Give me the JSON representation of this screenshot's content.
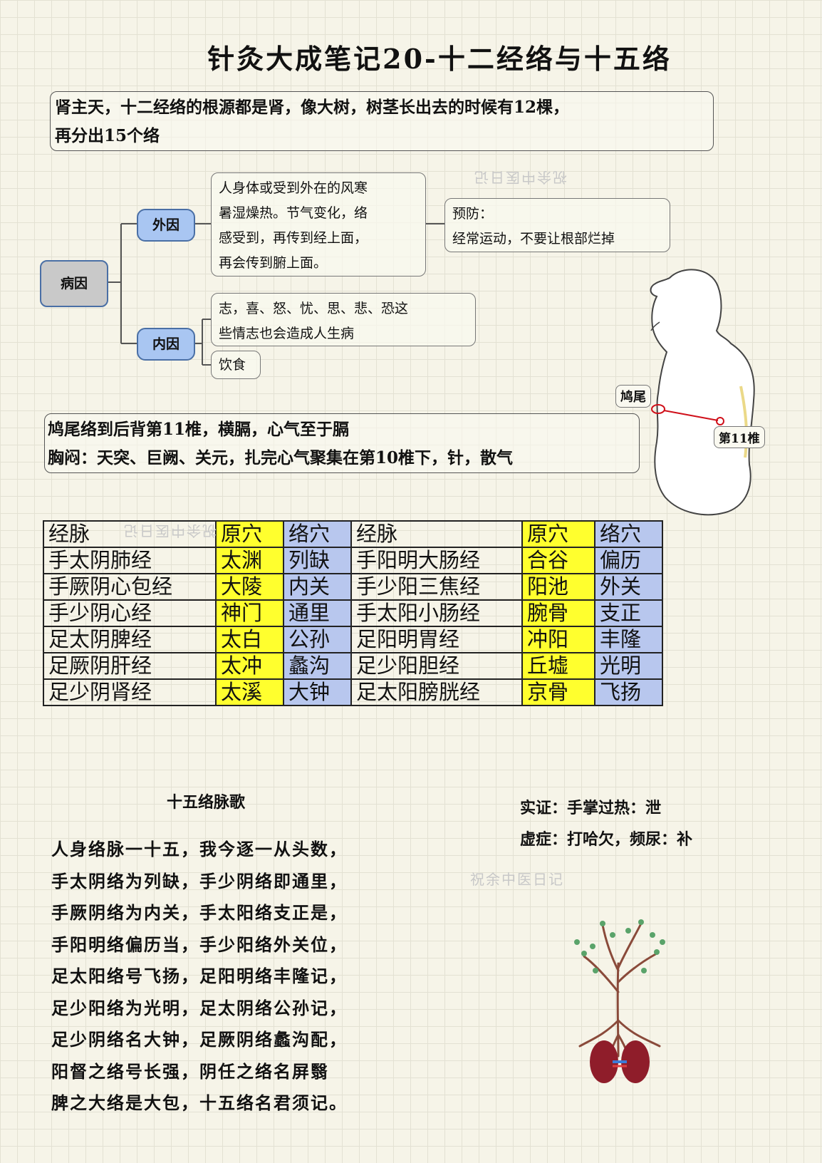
{
  "title": "针灸大成笔记20-十二经络与十五络",
  "intro": {
    "line1": "肾主天，十二经络的根源都是肾，像大树，树茎长出去的时候有12棵，",
    "line2": "再分出15个络"
  },
  "mindmap": {
    "root": "病因",
    "waiyin": {
      "label": "外因",
      "desc": [
        "人身体或受到外在的风寒",
        "暑湿燥热。节气变化，络",
        "感受到，再传到经上面，",
        "再会传到腑上面。"
      ],
      "prevention": [
        "预防：",
        "经常运动，不要让根部烂掉"
      ]
    },
    "neiyin": {
      "label": "内因",
      "emotions": [
        "志，喜、怒、忧、思、悲、恐这",
        "些情志也会造成人生病"
      ],
      "diet": "饮食"
    }
  },
  "figure": {
    "label_jiuwei": "鸠尾",
    "label_vertebra": "第11椎"
  },
  "jiuwei_note": {
    "line1": "鸠尾络到后背第11椎，横膈，心气至于膈",
    "line2": "胸闷：天突、巨阙、关元，扎完心气聚集在第10椎下，针，散气"
  },
  "table": {
    "headers": [
      "经脉",
      "原穴",
      "络穴",
      "经脉",
      "原穴",
      "络穴"
    ],
    "rows": [
      [
        "手太阴肺经",
        "太渊",
        "列缺",
        "手阳明大肠经",
        "合谷",
        "偏历"
      ],
      [
        "手厥阴心包经",
        "大陵",
        "内关",
        "手少阳三焦经",
        "阳池",
        "外关"
      ],
      [
        "手少阴心经",
        "神门",
        "通里",
        "手太阳小肠经",
        "腕骨",
        "支正"
      ],
      [
        "足太阴脾经",
        "太白",
        "公孙",
        "足阳明胃经",
        "冲阳",
        "丰隆"
      ],
      [
        "足厥阴肝经",
        "太冲",
        "蠡沟",
        "足少阳胆经",
        "丘墟",
        "光明"
      ],
      [
        "足少阴肾经",
        "太溪",
        "大钟",
        "足太阳膀胱经",
        "京骨",
        "飞扬"
      ]
    ]
  },
  "song": {
    "title": "十五络脉歌",
    "lines": [
      "人身络脉一十五，我今逐一从头数，",
      "手太阴络为列缺，手少阴络即通里，",
      "手厥阴络为内关，手太阳络支正是，",
      "手阳明络偏历当，手少阳络外关位，",
      "足太阳络号飞扬，足阳明络丰隆记，",
      "足少阳络为光明，足太阴络公孙记，",
      "足少阴络名大钟，足厥阴络蠡沟配，",
      "阳督之络号长强，阴任之络名屏翳",
      "脾之大络是大包，十五络名君须记。"
    ]
  },
  "shi_xu": {
    "shi": "实证：手掌过热：泄",
    "xu": "虚症：打哈欠，频尿：补"
  },
  "watermark": "祝余中医日记",
  "colors": {
    "yuan_col": "#ffff2e",
    "luo_col": "#b8c7ee",
    "node_blue": "#a9c6f2",
    "node_gray": "#c9c9c9"
  },
  "icons": [
    "human-torso-illustration",
    "kidney-tree-illustration"
  ]
}
